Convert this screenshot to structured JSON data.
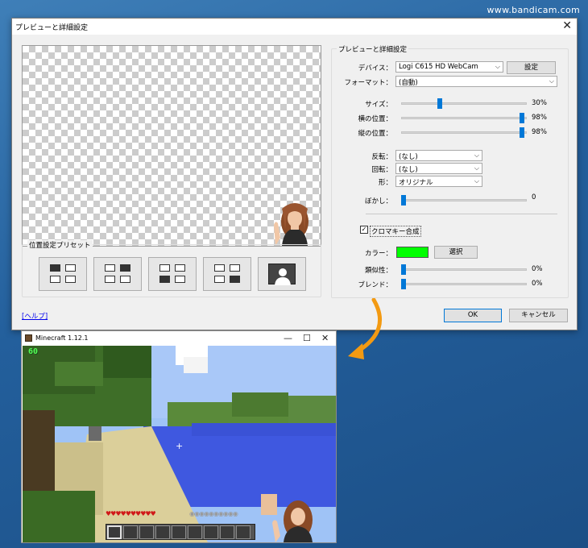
{
  "watermark": "www.bandicam.com",
  "dialog": {
    "title": "プレビューと詳細設定",
    "close_glyph": "✕",
    "preset_group_label": "位置設定プリセット",
    "right_group_label": "プレビューと詳細設定",
    "device_label": "デバイス：",
    "device_value": "Logi C615 HD WebCam",
    "device_settings_button": "設定",
    "format_label": "フォーマット：",
    "format_value": "(自動)",
    "size_label": "サイズ：",
    "size_value": "30%",
    "size_level": 0.3,
    "hpos_label": "横の位置：",
    "hpos_value": "98%",
    "hpos_level": 0.98,
    "vpos_label": "縦の位置：",
    "vpos_value": "98%",
    "vpos_level": 0.98,
    "flip_label": "反転：",
    "flip_value": "(なし)",
    "rotate_label": "回転：",
    "rotate_value": "(なし)",
    "shape_label": "形：",
    "shape_value": "オリジナル",
    "blur_label": "ぼかし：",
    "blur_value": "0",
    "blur_level": 0.0,
    "chroma_checked": true,
    "chroma_label": "クロマキー合成",
    "color_label": "カラー：",
    "chroma_color": "#00ff00",
    "select_button": "選択",
    "similarity_label": "類似性：",
    "similarity_value": "0%",
    "similarity_level": 0.0,
    "blend_label": "ブレンド：",
    "blend_value": "0%",
    "blend_level": 0.0,
    "help_link": "[ヘルプ]",
    "ok_button": "OK",
    "cancel_button": "キャンセル",
    "accent_color": "#0078d7"
  },
  "minecraft": {
    "title": "Minecraft 1.12.1",
    "fps": "60",
    "minimize_glyph": "—",
    "maximize_glyph": "☐",
    "close_glyph": "✕",
    "hearts": "♥♥♥♥♥♥♥♥♥♥",
    "armor": "◉◉◉◉◉◉◉◉◉◉"
  }
}
